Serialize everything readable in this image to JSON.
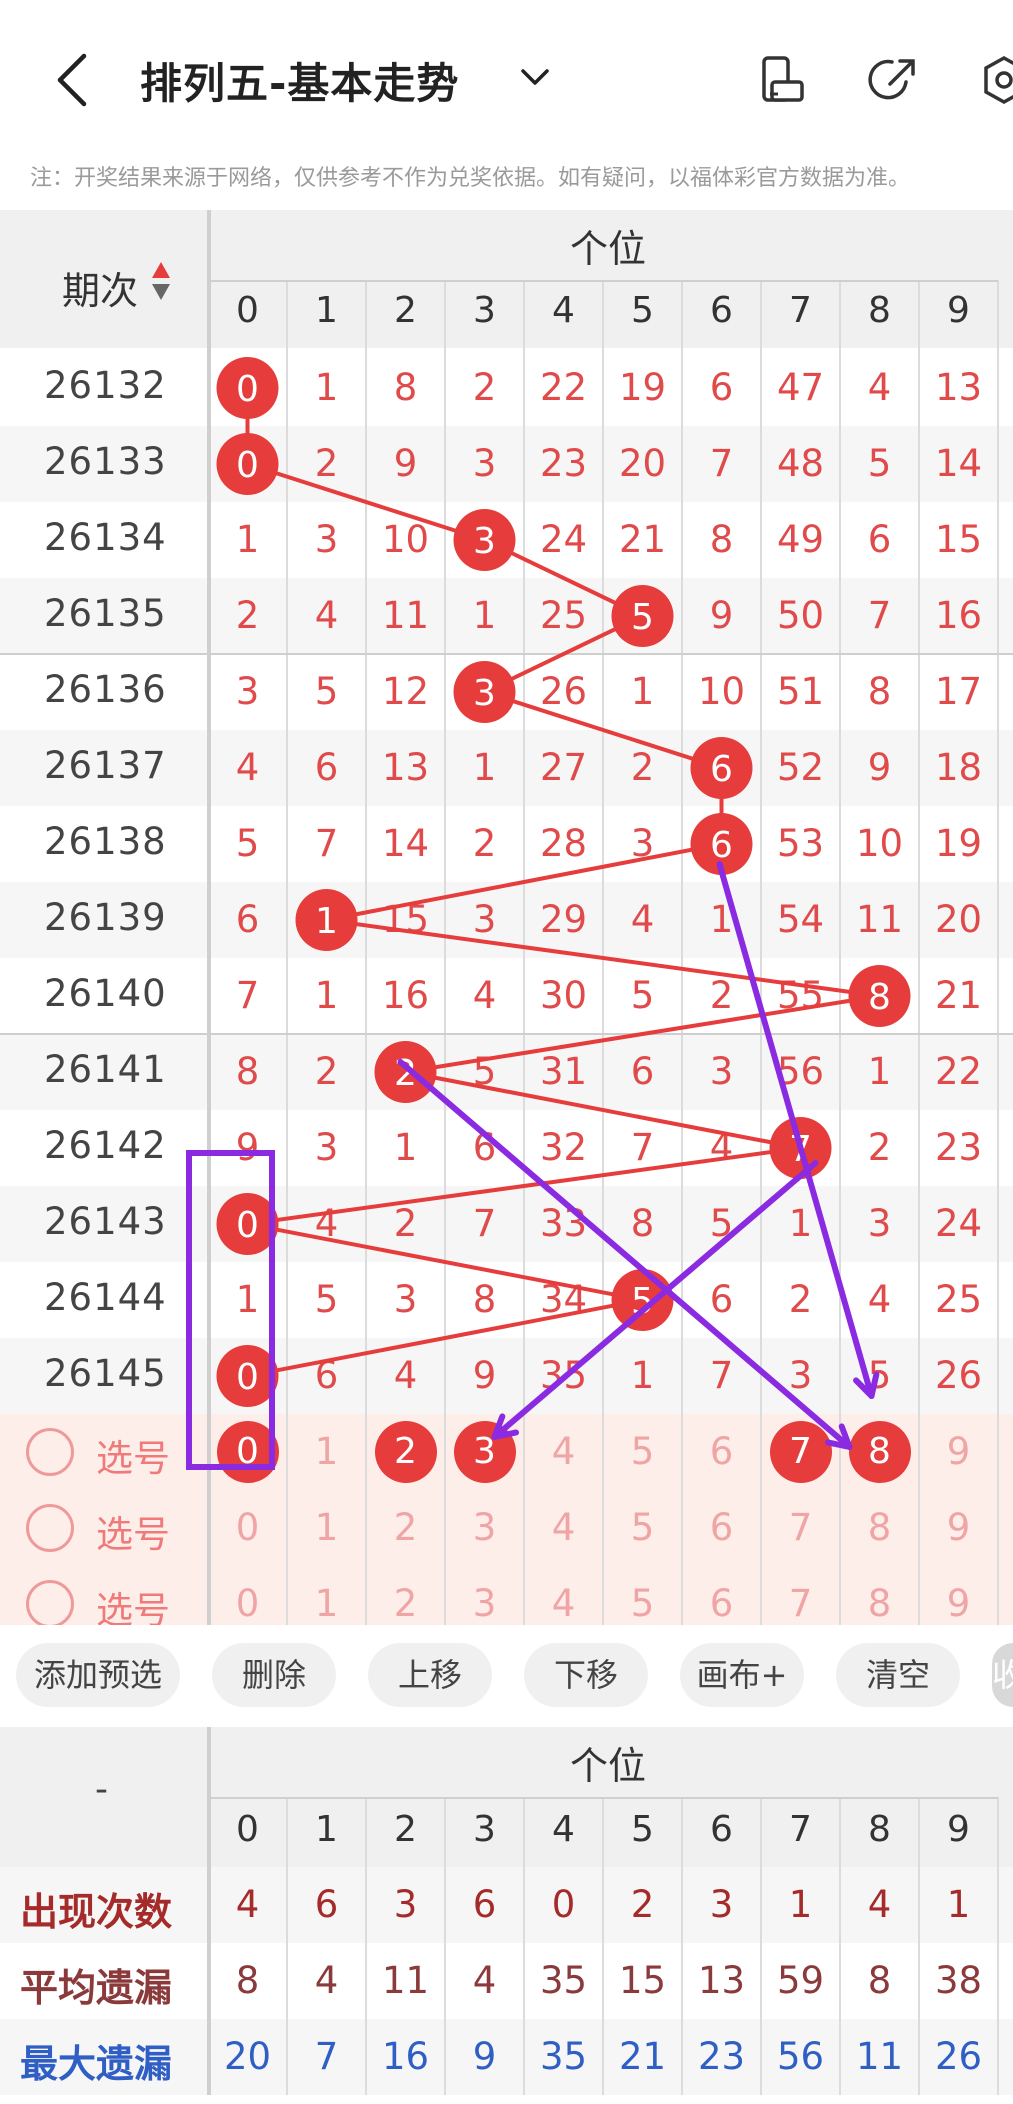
{
  "header": {
    "title": "排列五-基本走势"
  },
  "note": "注：开奖结果来源于网络，仅供参考不作为兑奖依据。如有疑问，以福体彩官方数据为准。",
  "table": {
    "period_label": "期次",
    "position_label": "个位",
    "digits": [
      "0",
      "1",
      "2",
      "3",
      "4",
      "5",
      "6",
      "7",
      "8",
      "9"
    ],
    "rows": [
      {
        "issue": "26132",
        "values": [
          "0",
          "1",
          "8",
          "2",
          "22",
          "19",
          "6",
          "47",
          "4",
          "13"
        ],
        "hit": 0
      },
      {
        "issue": "26133",
        "values": [
          "0",
          "2",
          "9",
          "3",
          "23",
          "20",
          "7",
          "48",
          "5",
          "14"
        ],
        "hit": 0
      },
      {
        "issue": "26134",
        "values": [
          "1",
          "3",
          "10",
          "3",
          "24",
          "21",
          "8",
          "49",
          "6",
          "15"
        ],
        "hit": 3
      },
      {
        "issue": "26135",
        "values": [
          "2",
          "4",
          "11",
          "1",
          "25",
          "5",
          "9",
          "50",
          "7",
          "16"
        ],
        "hit": 5
      },
      {
        "issue": "26136",
        "values": [
          "3",
          "5",
          "12",
          "3",
          "26",
          "1",
          "10",
          "51",
          "8",
          "17"
        ],
        "hit": 3
      },
      {
        "issue": "26137",
        "values": [
          "4",
          "6",
          "13",
          "1",
          "27",
          "2",
          "6",
          "52",
          "9",
          "18"
        ],
        "hit": 6
      },
      {
        "issue": "26138",
        "values": [
          "5",
          "7",
          "14",
          "2",
          "28",
          "3",
          "6",
          "53",
          "10",
          "19"
        ],
        "hit": 6
      },
      {
        "issue": "26139",
        "values": [
          "6",
          "1",
          "15",
          "3",
          "29",
          "4",
          "1",
          "54",
          "11",
          "20"
        ],
        "hit": 1
      },
      {
        "issue": "26140",
        "values": [
          "7",
          "1",
          "16",
          "4",
          "30",
          "5",
          "2",
          "55",
          "8",
          "21"
        ],
        "hit": 8
      },
      {
        "issue": "26141",
        "values": [
          "8",
          "2",
          "2",
          "5",
          "31",
          "6",
          "3",
          "56",
          "1",
          "22"
        ],
        "hit": 2
      },
      {
        "issue": "26142",
        "values": [
          "9",
          "3",
          "1",
          "6",
          "32",
          "7",
          "4",
          "7",
          "2",
          "23"
        ],
        "hit": 7
      },
      {
        "issue": "26143",
        "values": [
          "0",
          "4",
          "2",
          "7",
          "33",
          "8",
          "5",
          "1",
          "3",
          "24"
        ],
        "hit": 0
      },
      {
        "issue": "26144",
        "values": [
          "1",
          "5",
          "3",
          "8",
          "34",
          "5",
          "6",
          "2",
          "4",
          "25"
        ],
        "hit": 5
      },
      {
        "issue": "26145",
        "values": [
          "0",
          "6",
          "4",
          "9",
          "35",
          "1",
          "7",
          "3",
          "5",
          "26"
        ],
        "hit": 0
      }
    ],
    "pick_rows": [
      {
        "label": "选号",
        "selected": [
          0,
          2,
          3,
          7,
          8
        ]
      },
      {
        "label": "选号",
        "selected": []
      },
      {
        "label": "选号",
        "selected": []
      }
    ]
  },
  "toolbar": {
    "buttons": [
      "添加预选",
      "删除",
      "上移",
      "下移",
      "画布+",
      "清空",
      "收"
    ]
  },
  "stats": {
    "corner": "-",
    "position_label": "个位",
    "digits": [
      "0",
      "1",
      "2",
      "3",
      "4",
      "5",
      "6",
      "7",
      "8",
      "9"
    ],
    "rows": [
      {
        "label": "出现次数",
        "values": [
          "4",
          "6",
          "3",
          "6",
          "0",
          "2",
          "3",
          "1",
          "4",
          "1"
        ],
        "color": "#a52a2a"
      },
      {
        "label": "平均遗漏",
        "values": [
          "8",
          "4",
          "11",
          "4",
          "35",
          "15",
          "13",
          "59",
          "8",
          "38"
        ],
        "color": "#8a3a3a"
      },
      {
        "label": "最大遗漏",
        "values": [
          "20",
          "7",
          "16",
          "9",
          "35",
          "21",
          "23",
          "56",
          "11",
          "26"
        ],
        "color": "#2f5fc4"
      }
    ]
  },
  "colors": {
    "accent": "#e63c3c",
    "annotation": "#8a2be2"
  }
}
